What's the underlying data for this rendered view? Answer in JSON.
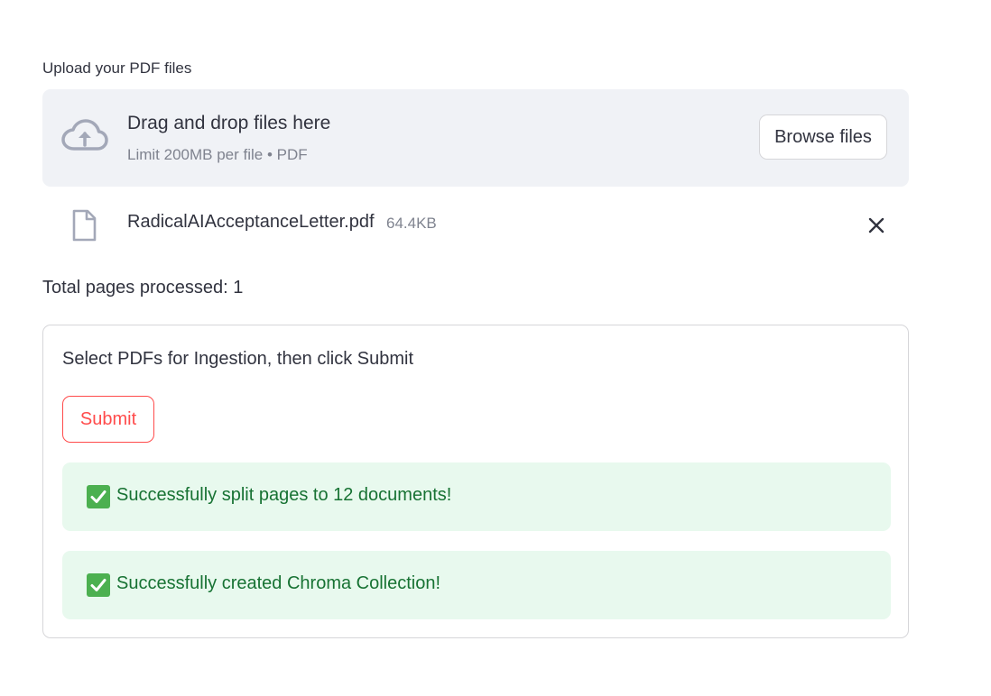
{
  "uploader": {
    "label": "Upload your PDF files",
    "dropzone_title": "Drag and drop files here",
    "dropzone_subtitle": "Limit 200MB per file • PDF",
    "browse_label": "Browse files",
    "icon": "cloud-upload-icon"
  },
  "file": {
    "name": "RadicalAIAcceptanceLetter.pdf",
    "size": "64.4KB",
    "icon": "file-icon",
    "remove_icon": "close-icon"
  },
  "status": {
    "total_pages": "Total pages processed: 1"
  },
  "form": {
    "title": "Select PDFs for Ingestion, then click Submit",
    "submit_label": "Submit",
    "alerts": [
      {
        "text": "Successfully split pages to 12 documents!",
        "icon": "check-mark-icon"
      },
      {
        "text": "Successfully created Chroma Collection!",
        "icon": "check-mark-icon"
      }
    ]
  },
  "colors": {
    "accent": "#ff4b4b",
    "success_bg": "#e8f9ee",
    "success_text": "#177233",
    "dropzone_bg": "#f0f2f6"
  }
}
